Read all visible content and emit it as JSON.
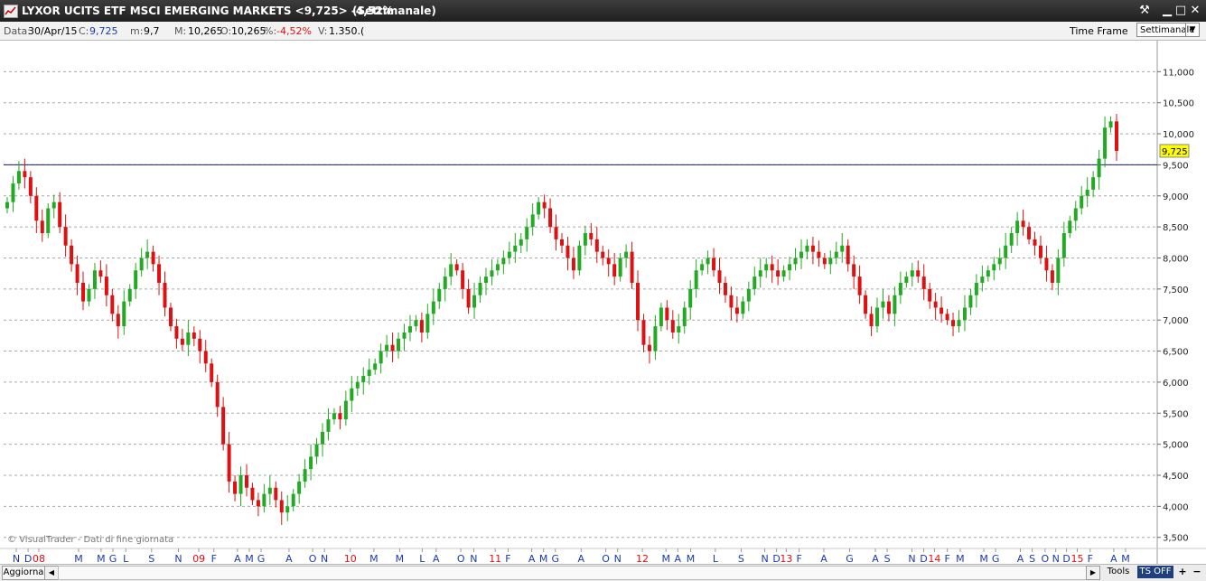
{
  "window": {
    "title": "LYXOR UCITS ETF MSCI EMERGING MARKETS <9,725> -4,52%",
    "period": "(Settimanale)"
  },
  "info": {
    "data_label": "Data:",
    "data_value": "30/Apr/15",
    "c_label": "C:",
    "c_value": "9,725",
    "m_label": "m:",
    "m_value": "9,7",
    "mx_label": "M:",
    "mx_value": "10,265",
    "o_label": "O:",
    "o_value": "10,265",
    "pct_label": "%:",
    "pct_value": "-4,52%",
    "v_label": "V:",
    "v_value": "1.350.("
  },
  "timeframe": {
    "label": "Time Frame",
    "selected": "Settimanale"
  },
  "watermark": "© VisualTrader - Dati di fine giornata",
  "bottom": {
    "aggiorna": "Aggiorna",
    "tools": "Tools",
    "tsoff": "TS OFF",
    "plus": "+",
    "minus": "−"
  },
  "colors": {
    "up": "#22aa22",
    "down": "#dd1111",
    "grid": "#a8a8a8",
    "ref_line": "#1a1a7a",
    "price_tag": "#ffff00",
    "month_label": "#1a3aaa",
    "year_label": "#dd1111"
  },
  "chart_data": {
    "type": "candlestick",
    "title": "LYXOR UCITS ETF MSCI EMERGING MARKETS",
    "y_ticks": [
      "11,000",
      "10,500",
      "10,000",
      "9,500",
      "9,000",
      "8,500",
      "8,000",
      "7,500",
      "7,000",
      "6,500",
      "6,000",
      "5,500",
      "5,000",
      "4,500",
      "4,000",
      "3,500"
    ],
    "ylim": [
      3.35,
      11.5
    ],
    "grid": true,
    "last_price_label": "9,725",
    "reference_line": 9.5,
    "x_labels": [
      {
        "t": "N",
        "x": 0.0,
        "year": false
      },
      {
        "t": "D",
        "x": 0.011,
        "year": false
      },
      {
        "t": "08",
        "x": 0.021,
        "year": true
      },
      {
        "t": "M",
        "x": 0.058,
        "year": false
      },
      {
        "t": "M",
        "x": 0.079,
        "year": false
      },
      {
        "t": "G",
        "x": 0.09,
        "year": false
      },
      {
        "t": "L",
        "x": 0.102,
        "year": false
      },
      {
        "t": "S",
        "x": 0.126,
        "year": false
      },
      {
        "t": "N",
        "x": 0.151,
        "year": false
      },
      {
        "t": "09",
        "x": 0.17,
        "year": true
      },
      {
        "t": "F",
        "x": 0.184,
        "year": false
      },
      {
        "t": "A",
        "x": 0.206,
        "year": false
      },
      {
        "t": "M",
        "x": 0.217,
        "year": false
      },
      {
        "t": "G",
        "x": 0.228,
        "year": false
      },
      {
        "t": "A",
        "x": 0.254,
        "year": false
      },
      {
        "t": "O",
        "x": 0.276,
        "year": false
      },
      {
        "t": "N",
        "x": 0.287,
        "year": false
      },
      {
        "t": "10",
        "x": 0.311,
        "year": true
      },
      {
        "t": "M",
        "x": 0.333,
        "year": false
      },
      {
        "t": "M",
        "x": 0.357,
        "year": false
      },
      {
        "t": "L",
        "x": 0.378,
        "year": false
      },
      {
        "t": "A",
        "x": 0.391,
        "year": false
      },
      {
        "t": "O",
        "x": 0.414,
        "year": false
      },
      {
        "t": "N",
        "x": 0.426,
        "year": false
      },
      {
        "t": "11",
        "x": 0.446,
        "year": true
      },
      {
        "t": "F",
        "x": 0.458,
        "year": false
      },
      {
        "t": "A",
        "x": 0.48,
        "year": false
      },
      {
        "t": "M",
        "x": 0.491,
        "year": false
      },
      {
        "t": "G",
        "x": 0.502,
        "year": false
      },
      {
        "t": "A",
        "x": 0.526,
        "year": false
      },
      {
        "t": "O",
        "x": 0.549,
        "year": false
      },
      {
        "t": "N",
        "x": 0.56,
        "year": false
      },
      {
        "t": "12",
        "x": 0.583,
        "year": true
      },
      {
        "t": "M",
        "x": 0.605,
        "year": false
      },
      {
        "t": "A",
        "x": 0.616,
        "year": false
      },
      {
        "t": "M",
        "x": 0.628,
        "year": false
      },
      {
        "t": "L",
        "x": 0.651,
        "year": false
      },
      {
        "t": "S",
        "x": 0.675,
        "year": false
      },
      {
        "t": "N",
        "x": 0.697,
        "year": false
      },
      {
        "t": "D",
        "x": 0.708,
        "year": false
      },
      {
        "t": "13",
        "x": 0.717,
        "year": true
      },
      {
        "t": "F",
        "x": 0.729,
        "year": false
      },
      {
        "t": "A",
        "x": 0.752,
        "year": false
      },
      {
        "t": "G",
        "x": 0.776,
        "year": false
      },
      {
        "t": "A",
        "x": 0.8,
        "year": false
      },
      {
        "t": "S",
        "x": 0.811,
        "year": false
      },
      {
        "t": "N",
        "x": 0.834,
        "year": false
      },
      {
        "t": "D",
        "x": 0.845,
        "year": false
      },
      {
        "t": "14",
        "x": 0.855,
        "year": true
      },
      {
        "t": "F",
        "x": 0.867,
        "year": false
      },
      {
        "t": "M",
        "x": 0.879,
        "year": false
      },
      {
        "t": "M",
        "x": 0.901,
        "year": false
      },
      {
        "t": "G",
        "x": 0.912,
        "year": false
      },
      {
        "t": "A",
        "x": 0.935,
        "year": false
      },
      {
        "t": "S",
        "x": 0.946,
        "year": false
      },
      {
        "t": "O",
        "x": 0.958,
        "year": false
      },
      {
        "t": "N",
        "x": 0.968,
        "year": false
      },
      {
        "t": "D",
        "x": 0.978,
        "year": false
      },
      {
        "t": "15",
        "x": 0.988,
        "year": true
      },
      {
        "t": "F",
        "x": 1.0,
        "year": false
      },
      {
        "t": "A",
        "x": 1.022,
        "year": false
      },
      {
        "t": "M",
        "x": 1.033,
        "year": false
      }
    ],
    "closes": [
      8.9,
      9.2,
      9.4,
      9.3,
      9.0,
      8.6,
      8.4,
      8.8,
      8.9,
      8.5,
      8.2,
      7.9,
      7.6,
      7.3,
      7.5,
      7.8,
      7.7,
      7.4,
      7.1,
      6.9,
      7.3,
      7.5,
      7.8,
      8.0,
      8.1,
      7.9,
      7.6,
      7.2,
      6.9,
      6.7,
      6.6,
      6.8,
      6.7,
      6.5,
      6.3,
      6.0,
      5.6,
      5.0,
      4.4,
      4.2,
      4.5,
      4.3,
      4.1,
      4.0,
      4.2,
      4.3,
      4.1,
      3.9,
      4.0,
      4.2,
      4.4,
      4.6,
      4.8,
      5.0,
      5.2,
      5.4,
      5.5,
      5.4,
      5.7,
      5.9,
      6.0,
      6.1,
      6.2,
      6.3,
      6.5,
      6.6,
      6.5,
      6.7,
      6.8,
      6.9,
      7.0,
      6.8,
      7.1,
      7.3,
      7.5,
      7.7,
      7.9,
      7.8,
      7.5,
      7.2,
      7.4,
      7.6,
      7.7,
      7.8,
      7.9,
      8.0,
      8.1,
      8.2,
      8.3,
      8.5,
      8.7,
      8.9,
      8.8,
      8.5,
      8.3,
      8.2,
      8.0,
      7.8,
      8.2,
      8.4,
      8.3,
      8.1,
      8.0,
      7.9,
      7.7,
      8.0,
      8.1,
      7.6,
      7.0,
      6.6,
      6.5,
      6.9,
      7.2,
      7.0,
      6.8,
      6.9,
      7.2,
      7.5,
      7.8,
      7.9,
      8.0,
      7.8,
      7.6,
      7.4,
      7.2,
      7.1,
      7.3,
      7.5,
      7.7,
      7.8,
      7.9,
      7.8,
      7.7,
      7.8,
      7.9,
      8.0,
      8.1,
      8.2,
      8.1,
      8.0,
      7.9,
      8.0,
      8.1,
      8.2,
      7.9,
      7.7,
      7.4,
      7.1,
      6.9,
      7.2,
      7.3,
      7.1,
      7.4,
      7.6,
      7.7,
      7.8,
      7.7,
      7.5,
      7.3,
      7.2,
      7.1,
      7.0,
      6.9,
      7.0,
      7.2,
      7.4,
      7.6,
      7.7,
      7.8,
      7.9,
      8.0,
      8.2,
      8.4,
      8.6,
      8.5,
      8.3,
      8.2,
      8.0,
      7.8,
      7.6,
      8.0,
      8.4,
      8.6,
      8.8,
      9.0,
      9.1,
      9.3,
      9.6,
      10.1,
      10.2,
      9.725
    ],
    "series": [
      {
        "name": "LYXOR UCITS ETF MSCI EMERGING MARKETS"
      }
    ]
  }
}
